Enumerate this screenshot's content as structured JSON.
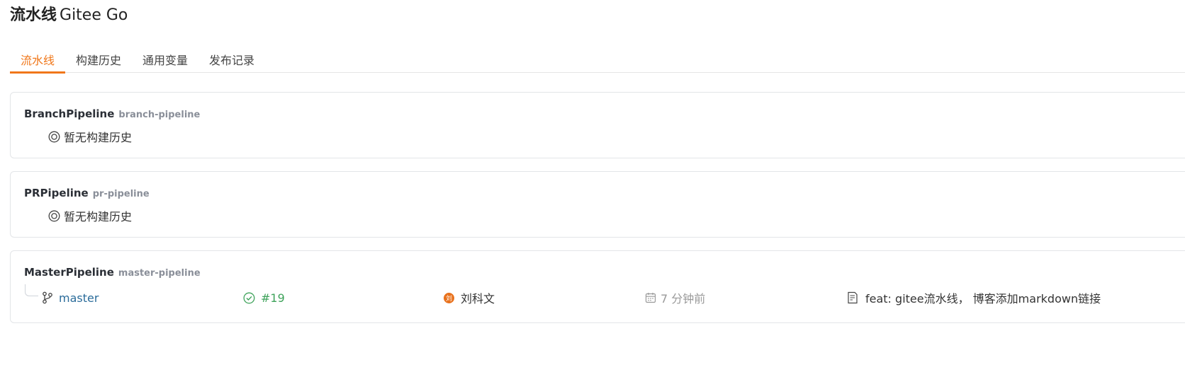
{
  "header": {
    "title": "流水线",
    "title_suffix": "Gitee Go"
  },
  "tabs": [
    {
      "label": "流水线",
      "active": true
    },
    {
      "label": "构建历史",
      "active": false
    },
    {
      "label": "通用变量",
      "active": false
    },
    {
      "label": "发布记录",
      "active": false
    }
  ],
  "pipelines": [
    {
      "name": "BranchPipeline",
      "id": "branch-pipeline",
      "empty_text": "暂无构建历史"
    },
    {
      "name": "PRPipeline",
      "id": "pr-pipeline",
      "empty_text": "暂无构建历史"
    },
    {
      "name": "MasterPipeline",
      "id": "master-pipeline",
      "run": {
        "branch": "master",
        "build_number": "#19",
        "author_initial": "刘",
        "author": "刘科文",
        "time": "7 分钟前",
        "commit_message": "feat: gitee流水线， 博客添加markdown链接"
      }
    }
  ],
  "colors": {
    "accent": "#f0771a",
    "success": "#3fa35b",
    "branch_link": "#2b6c9a",
    "avatar": "#e8711c"
  }
}
